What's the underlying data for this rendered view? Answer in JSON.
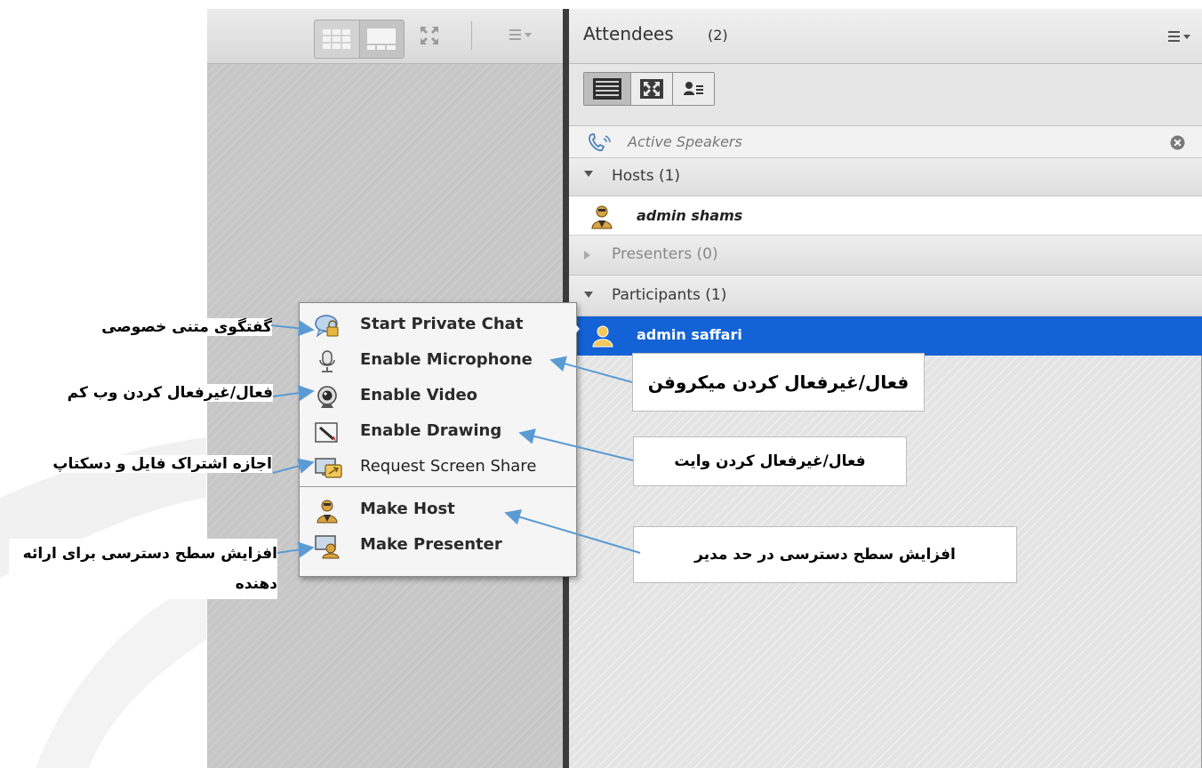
{
  "theme": {
    "selection_color": "#1363d6",
    "arrow_color": "#5b9bd5",
    "divider_color": "#3b3b3b"
  },
  "left_pod": {
    "toolbar_icons": [
      "grid-layout-icon",
      "filmstrip-layout-icon",
      "fullscreen-icon",
      "pod-menu-icon"
    ]
  },
  "attendees": {
    "title": "Attendees",
    "count": "(2)",
    "view_buttons": [
      "list-view-icon",
      "breakout-view-icon",
      "attendee-status-icon"
    ],
    "active_speakers": "Active Speakers",
    "sections": {
      "hosts": "Hosts (1)",
      "presenters": "Presenters (0)",
      "participants": "Participants (1)"
    },
    "host_name": "admin shams",
    "participant_name": "admin saffari"
  },
  "context_menu": {
    "items": [
      "Start Private Chat",
      "Enable Microphone",
      "Enable Video",
      "Enable Drawing",
      "Request Screen Share",
      "Make Host",
      "Make Presenter"
    ]
  },
  "annotations": {
    "private_chat": "گفتگوی متنی خصوصی",
    "microphone": "فعال/غیرفعال کردن میکروفن",
    "webcam": "فعال/غیرفعال کردن وب کم",
    "whiteboard": "فعال/غیرفعال کردن وایت",
    "share": "اجازه اشتراک فایل و دسکتاپ",
    "make_host": "افزایش سطح دسترسی در حد مدیر",
    "make_presenter_line1": "افزایش سطح دسترسی برای ارائه",
    "make_presenter_line2": "دهنده"
  }
}
